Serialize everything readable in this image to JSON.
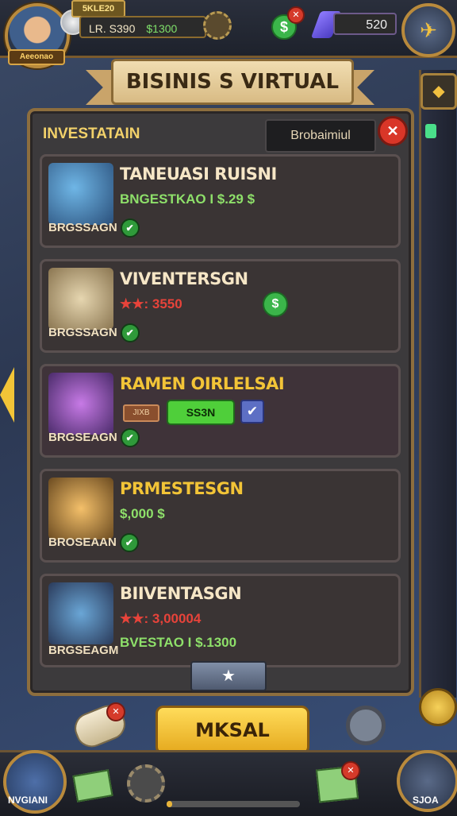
{
  "header": {
    "avatar_name": "Aeeonao",
    "level_badge": "5KLE20",
    "money_label": "LR. S390",
    "money_extra": "$1300",
    "gems": "520"
  },
  "title": "BISINIS S VIRTUAL",
  "panel": {
    "section_title": "INVESTATAIN",
    "search_value": "Brobaimiul"
  },
  "cards": [
    {
      "title": "TANEUASI RUISNI",
      "sub": "BNGESTKAO I $.29 $",
      "foot": "BRGSSAGN"
    },
    {
      "title": "VIVENTERSGN",
      "stars": "★★:",
      "value": "3550",
      "foot": "BRGSSAGN"
    },
    {
      "title": "RAMEN OIRLELSAI",
      "tag": "JIXB",
      "button": "SS3N",
      "foot": "BRGSEAGN"
    },
    {
      "title": "PRMESTESGN",
      "value": "$,000 $",
      "foot": "BROSEAAN"
    },
    {
      "title": "BIIVENTASGN",
      "stars": "★★:",
      "value": "3,00004",
      "sub": "BVESTAO I $.1300",
      "foot": "BRGSEAGM"
    }
  ],
  "actions": {
    "main_button": "MKSAL",
    "bottom_left_label": "NVGIANI",
    "bottom_right_label": "SJOA"
  },
  "progress": {
    "bottom_bar_fraction": 0.04
  },
  "colors": {
    "accent": "#f2c437",
    "positive": "#8ee06a",
    "negative": "#e7433a"
  }
}
